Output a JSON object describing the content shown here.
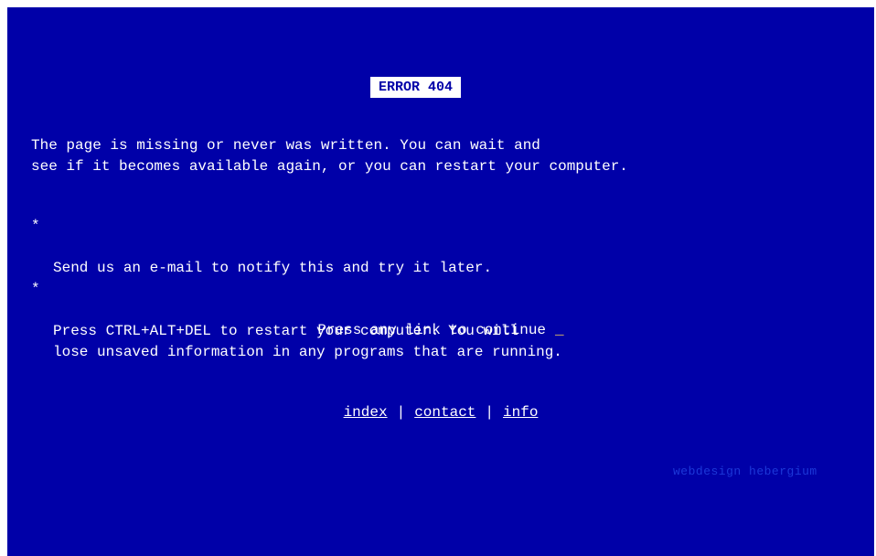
{
  "error": {
    "title": "ERROR 404"
  },
  "intro": {
    "text": "The page is missing or never was written. You can wait and\nsee if it becomes available again, or you can restart your computer."
  },
  "bullets": {
    "mark": "*",
    "items": [
      "Send us an e-mail to notify this and try it later.",
      "Press CTRL+ALT+DEL to restart your computer. You will\nlose unsaved information in any programs that are running."
    ]
  },
  "continue": {
    "text": "Press any link to continue",
    "cursor": "_"
  },
  "links": {
    "separator": "|",
    "items": [
      "index",
      "contact",
      "info"
    ]
  },
  "footer": {
    "note": "webdesign hebergium"
  },
  "colors": {
    "background": "#0000a8",
    "text": "#ffffff",
    "cursor": "#ffd75a",
    "note": "#1c38d8"
  }
}
